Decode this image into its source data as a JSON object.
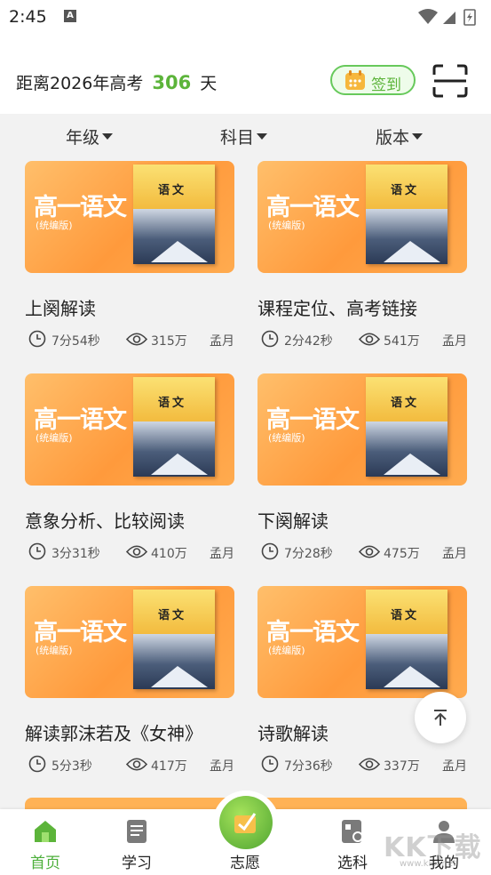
{
  "status_bar": {
    "time": "2:45",
    "a_badge": "A"
  },
  "header": {
    "countdown_prefix": "距离2026年高考",
    "countdown_days": "306",
    "countdown_suffix": "天",
    "checkin_label": "签到"
  },
  "filters": [
    {
      "label": "年级"
    },
    {
      "label": "科目"
    },
    {
      "label": "版本"
    }
  ],
  "cover": {
    "title": "高一语文",
    "subtitle": "(统编版)",
    "book_title": "语文"
  },
  "cards": [
    {
      "title": "上阕解读",
      "duration": "7分54秒",
      "views": "315万",
      "author": "孟月"
    },
    {
      "title": "课程定位、高考链接",
      "duration": "2分42秒",
      "views": "541万",
      "author": "孟月"
    },
    {
      "title": "意象分析、比较阅读",
      "duration": "3分31秒",
      "views": "410万",
      "author": "孟月"
    },
    {
      "title": "下阕解读",
      "duration": "7分28秒",
      "views": "475万",
      "author": "孟月"
    },
    {
      "title": "解读郭沫若及《女神》",
      "duration": "5分3秒",
      "views": "417万",
      "author": "孟月"
    },
    {
      "title": "诗歌解读",
      "duration": "7分36秒",
      "views": "337万",
      "author": "孟月"
    }
  ],
  "bottom_nav": [
    {
      "label": "首页",
      "icon": "home-icon",
      "active": true
    },
    {
      "label": "学习",
      "icon": "study-icon",
      "active": false
    },
    {
      "label": "志愿",
      "icon": "volunteer-icon",
      "active": false
    },
    {
      "label": "选科",
      "icon": "subject-select-icon",
      "active": false
    },
    {
      "label": "我的",
      "icon": "profile-icon",
      "active": false
    }
  ],
  "colors": {
    "accent_green": "#5cb43a",
    "cover_orange": "#ff9a3c"
  },
  "watermark": {
    "text": "KK下载",
    "url_text": "www.kkx.net"
  }
}
